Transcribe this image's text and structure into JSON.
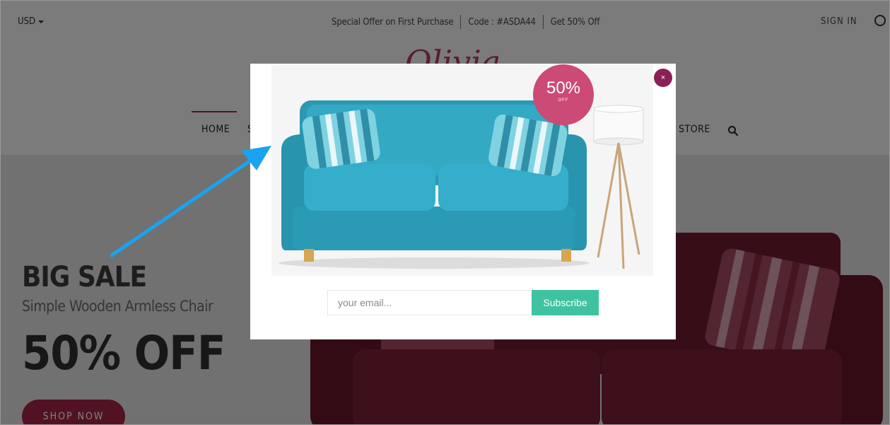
{
  "topbar": {
    "currency": "USD",
    "offer_text": "Special Offer on First Purchase",
    "code_text": "Code : #ASDA44",
    "discount_text": "Get 50% Off",
    "sign_in": "SIGN IN"
  },
  "header": {
    "logo": "Olivia",
    "nav": {
      "home": "HOME",
      "partial": "S",
      "store": "STORE"
    }
  },
  "hero": {
    "heading": "BIG SALE",
    "subtitle": "Simple Wooden Armless Chair",
    "discount": "50% OFF",
    "cta": "SHOP NOW"
  },
  "popup": {
    "badge_value": "50%",
    "badge_label": "OFF",
    "close_label": "×",
    "email_placeholder": "your email...",
    "subscribe_label": "Subscribe"
  },
  "colors": {
    "brand": "#a32549",
    "badge": "#cc4a76",
    "close": "#8b1f57",
    "subscribe": "#3fc2a0",
    "sofa_teal": "#2aa5bd",
    "hero_sofa": "#6e1a30",
    "annotation_arrow": "#1aa3f0"
  }
}
